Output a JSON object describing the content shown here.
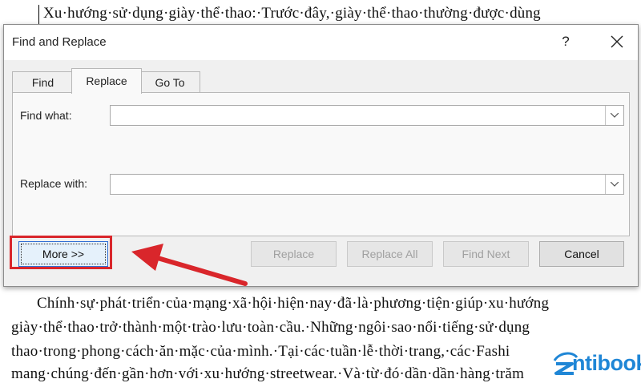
{
  "document": {
    "lines": [
      "Xu·hướng·sử·dụng·giày·thể·thao:·Trước·đây,·giày·thể·thao·thường·được·dùng",
      "Chính·sự·phát·triển·của·mạng·xã·hội·hiện·nay·đã·là·phương·tiện·giúp·xu·hướng",
      "giày·thể·thao·trở·thành·một·trào·lưu·toàn·cầu.·Những·ngôi·sao·nổi·tiếng·sử·dụng",
      "thao·trong·phong·cách·ăn·mặc·của·mình.·Tại·các·tuần·lễ·thời·trang,·các·Fashi",
      "mang·chúng·đến·gần·hơn·với·xu·hướng·streetwear.·Và·từ·đó·dần·dần·hàng·trăm"
    ]
  },
  "dialog": {
    "title": "Find and Replace",
    "help_label": "?",
    "tabs": [
      {
        "label": "Find",
        "active": false
      },
      {
        "label": "Replace",
        "active": true
      },
      {
        "label": "Go To",
        "active": false
      }
    ],
    "find_label": "Find what:",
    "find_value": "",
    "replace_label": "Replace with:",
    "replace_value": "",
    "buttons": {
      "more": "More >>",
      "replace": "Replace",
      "replace_all": "Replace All",
      "find_next": "Find Next",
      "cancel": "Cancel"
    }
  },
  "annotation": {
    "color": "#d9262b"
  },
  "logo": {
    "text": "ntibook",
    "color": "#1f86d6"
  }
}
